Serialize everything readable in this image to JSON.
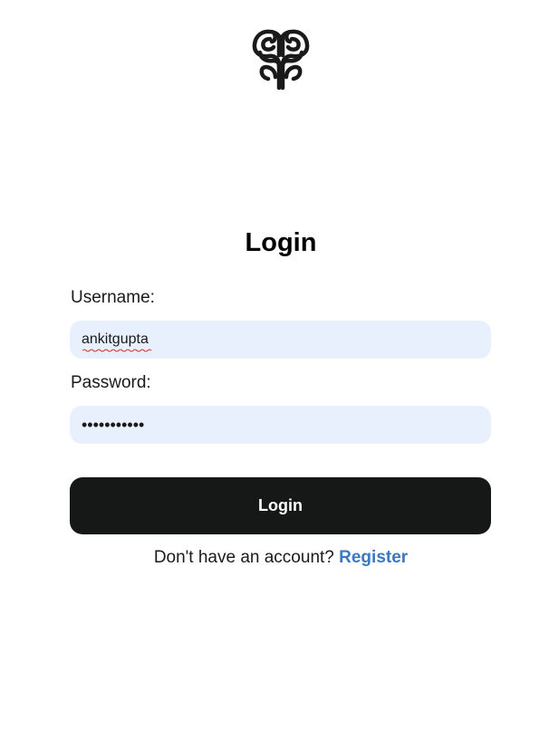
{
  "logo": {
    "icon": "brain-icon"
  },
  "form": {
    "title": "Login",
    "username_label": "Username:",
    "username_value": "ankitgupta",
    "password_label": "Password:",
    "password_value": "•••••••••••",
    "submit_label": "Login"
  },
  "footer": {
    "prompt": "Don't have an account?",
    "register_link": "Register"
  },
  "colors": {
    "input_bg": "#e8f0fe",
    "button_bg": "#161818",
    "link": "#3a78c2"
  }
}
